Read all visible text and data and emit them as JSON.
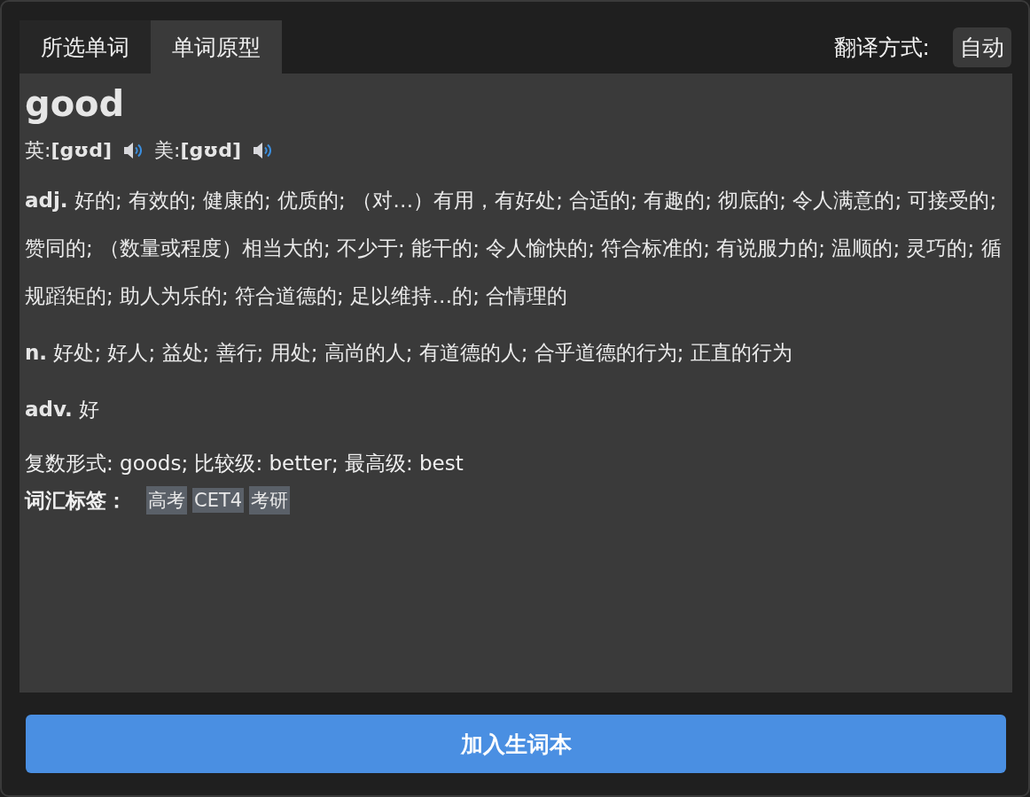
{
  "tabs": [
    {
      "label": "所选单词",
      "selected": false
    },
    {
      "label": "单词原型",
      "selected": true
    }
  ],
  "translate_mode": {
    "label": "翻译方式:",
    "value": "自动"
  },
  "entry": {
    "word": "good",
    "pronunciations": [
      {
        "text": "英:**[gʊd]**"
      },
      {
        "text": "美:**[gʊd]**"
      }
    ],
    "definitions": [
      "**adj.** 好的; 有效的; 健康的; 优质的; （对…）有用，有好处; 合适的; 有趣的; 彻底的; 令人满意的; 可接受的; 赞同的; （数量或程度）相当大的; 不少于; 能干的; 令人愉快的; 符合标准的; 有说服力的; 温顺的; 灵巧的; 循规蹈矩的; 助人为乐的; 符合道德的; 足以维持…的; 合情理的",
      "**n.** 好处; 好人; 益处; 善行; 用处; 高尚的人; 有道德的人; 合乎道德的行为; 正直的行为",
      "**adv.** 好"
    ],
    "forms": "复数形式: goods; 比较级: better; 最高级: best",
    "tags_label": "词汇标签：",
    "tags": [
      "高考",
      "CET4",
      "考研"
    ]
  },
  "add_button": "加入生词本"
}
